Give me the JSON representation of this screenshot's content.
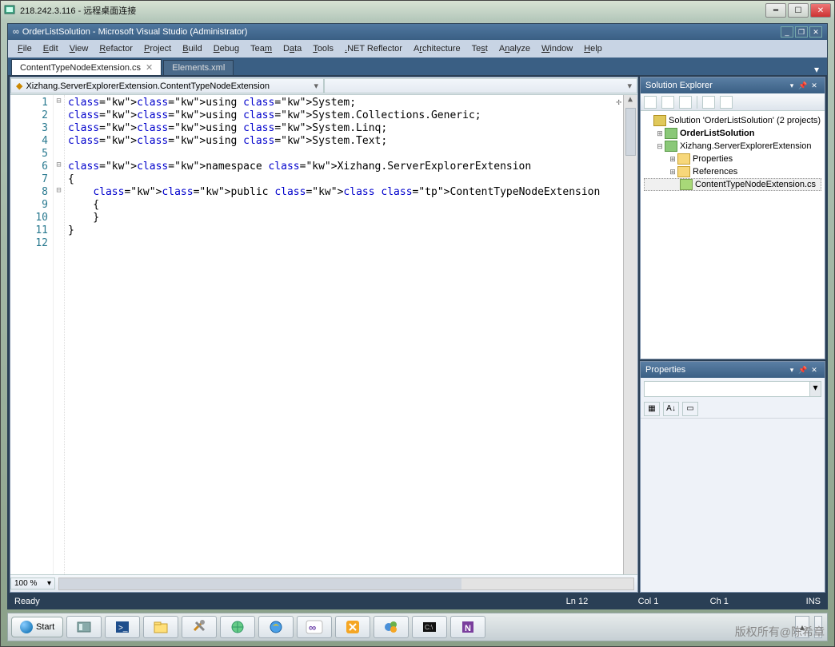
{
  "remote": {
    "title": "218.242.3.116 - 远程桌面连接"
  },
  "vs": {
    "title": "OrderListSolution - Microsoft Visual Studio (Administrator)",
    "menu": [
      "File",
      "Edit",
      "View",
      "Refactor",
      "Project",
      "Build",
      "Debug",
      "Team",
      "Data",
      "Tools",
      ".NET Reflector",
      "Architecture",
      "Test",
      "Analyze",
      "Window",
      "Help"
    ]
  },
  "tabs": {
    "active": "ContentTypeNodeExtension.cs",
    "other": "Elements.xml"
  },
  "breadcrumb": {
    "left": "Xizhang.ServerExplorerExtension.ContentTypeNodeExtension",
    "right": ""
  },
  "code": {
    "lines": [
      {
        "n": "1",
        "f": "⊟",
        "h": "using <kw>System</kw>;",
        "pre": ""
      },
      {
        "n": "2",
        "f": "",
        "h": "using <kw>System.Collections.Generic</kw>;",
        "pre": ""
      },
      {
        "n": "3",
        "f": "",
        "h": "using <kw>System.Linq</kw>;",
        "pre": ""
      },
      {
        "n": "4",
        "f": "",
        "h": "using <kw>System.Text</kw>;",
        "pre": ""
      },
      {
        "n": "5",
        "f": "",
        "h": "",
        "pre": ""
      },
      {
        "n": "6",
        "f": "⊟",
        "h": "namespace <kw>Xizhang.ServerExplorerExtension</kw>",
        "pre": ""
      },
      {
        "n": "7",
        "f": "",
        "h": "{",
        "pre": ""
      },
      {
        "n": "8",
        "f": "⊟",
        "h": "    public class <tp>ContentTypeNodeExtension</tp>",
        "pre": ""
      },
      {
        "n": "9",
        "f": "",
        "h": "    {",
        "pre": ""
      },
      {
        "n": "10",
        "f": "",
        "h": "    }",
        "pre": ""
      },
      {
        "n": "11",
        "f": "",
        "h": "}",
        "pre": ""
      },
      {
        "n": "12",
        "f": "",
        "h": "",
        "pre": ""
      }
    ]
  },
  "zoom": "100 %",
  "solution": {
    "title": "Solution Explorer",
    "root": "Solution 'OrderListSolution' (2 projects)",
    "p1": "OrderListSolution",
    "p2": "Xizhang.ServerExplorerExtension",
    "n1": "Properties",
    "n2": "References",
    "n3": "ContentTypeNodeExtension.cs"
  },
  "properties": {
    "title": "Properties"
  },
  "status": {
    "ready": "Ready",
    "ln": "Ln 12",
    "col": "Col 1",
    "ch": "Ch 1",
    "ins": "INS"
  },
  "taskbar": {
    "start": "Start"
  },
  "watermark": "版权所有@陈希章"
}
